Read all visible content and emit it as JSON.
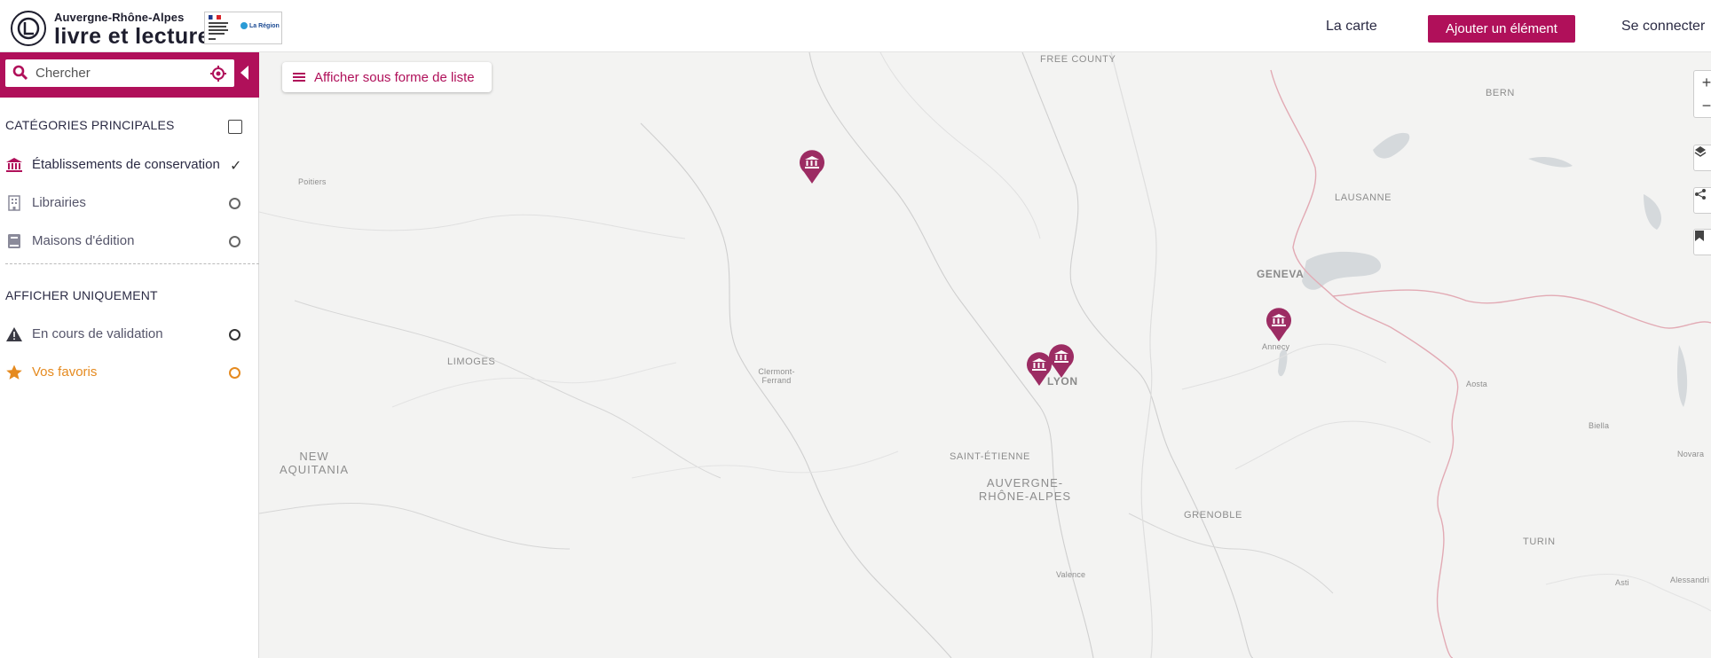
{
  "header": {
    "brand_top": "Auvergne-Rhône-Alpes",
    "brand_main": "livre et lecture",
    "partner_region": "La Région",
    "nav": {
      "map": "La carte",
      "add": "Ajouter un élément",
      "login": "Se connecter"
    }
  },
  "sidebar": {
    "search_placeholder": "Chercher",
    "categories_title": "CATÉGORIES PRINCIPALES",
    "categories": [
      {
        "label": "Établissements de conservation",
        "icon": "museum-icon",
        "selected": true
      },
      {
        "label": "Librairies",
        "icon": "building-icon",
        "selected": false
      },
      {
        "label": "Maisons d'édition",
        "icon": "book-icon",
        "selected": false
      }
    ],
    "only_title": "AFFICHER UNIQUEMENT",
    "filters": [
      {
        "label": "En cours de validation",
        "icon": "warning-icon",
        "selected": false
      },
      {
        "label": "Vos favoris",
        "icon": "star-icon",
        "selected": false
      }
    ]
  },
  "map": {
    "list_button": "Afficher sous forme de liste",
    "places": {
      "free_county": "FREE COUNTY",
      "bern": "BERN",
      "poitiers": "Poitiers",
      "lausanne": "LAUSANNE",
      "geneva": "GENEVA",
      "annecy": "Annecy",
      "limoges": "LIMOGES",
      "clermont": "Clermont-Ferrand",
      "lyon": "LYON",
      "aosta": "Aosta",
      "biella": "Biella",
      "novara": "Novara",
      "new_aquitania": "NEW AQUITANIA",
      "saint_etienne": "SAINT-ÉTIENNE",
      "auvergne": "AUVERGNE-RHÔNE-ALPES",
      "grenoble": "GRENOBLE",
      "turin": "TURIN",
      "valence": "Valence",
      "asti": "Asti",
      "alessandria": "Alessandri"
    },
    "controls": [
      "+",
      "−"
    ],
    "accent_color": "#b0105a",
    "marker_color": "#9c2c63"
  }
}
